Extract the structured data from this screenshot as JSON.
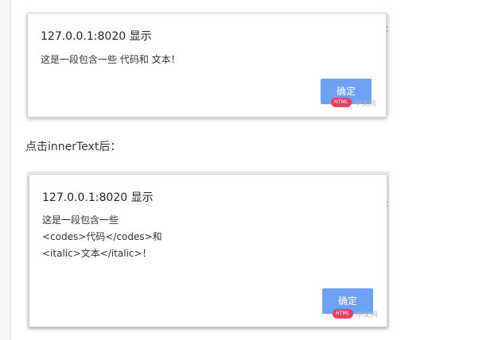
{
  "dialogs": [
    {
      "title": "127.0.0.1:8020 显示",
      "message_lines": [
        "这是一段包含一些 代码和 文本！"
      ],
      "button_label": "确定",
      "watermark": {
        "badge": "HTML",
        "text": "中文网"
      }
    },
    {
      "title": "127.0.0.1:8020 显示",
      "message_lines": [
        "这是一段包含一些",
        "<codes>代码</codes>和",
        "<italic>文本</italic>！"
      ],
      "button_label": "确定",
      "watermark": {
        "badge": "HTML",
        "text": "中文网"
      }
    }
  ],
  "section_label": "点击innerText后：",
  "colors": {
    "button": "#6ea0f4",
    "watermark_badge": "#e43f64",
    "page_background": "#ffffff"
  }
}
